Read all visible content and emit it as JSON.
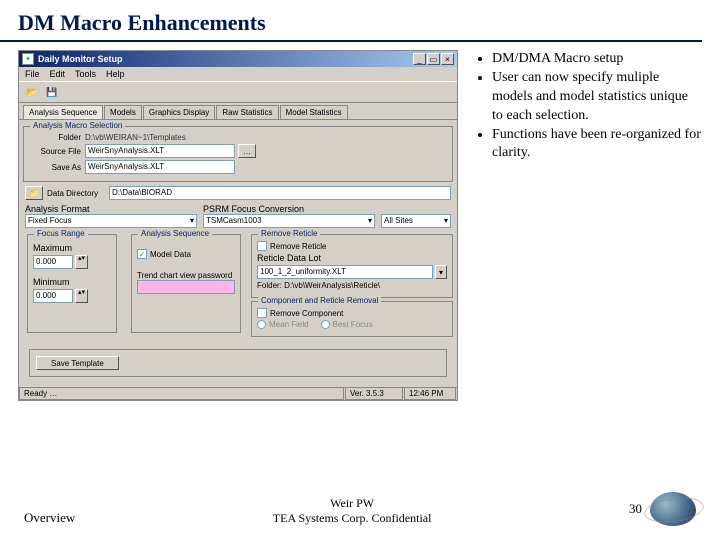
{
  "slide": {
    "title": "DM Macro Enhancements",
    "footer_left": "Overview",
    "footer_center_top": "Weir PW",
    "footer_center_bottom": "TEA Systems Corp. Confidential",
    "page_number": "30"
  },
  "bullets": {
    "b1": "DM/DMA Macro setup",
    "b2": "User can now specify muliple models and model statistics unique to each selection.",
    "b3": "Functions have been re-organized for clarity."
  },
  "app": {
    "title": "Daily Monitor Setup",
    "menu": {
      "file": "File",
      "edit": "Edit",
      "tools": "Tools",
      "help": "Help"
    },
    "tabs": {
      "t1": "Analysis Sequence",
      "t2": "Models",
      "t3": "Graphics Display",
      "t4": "Raw Statistics",
      "t5": "Model Statistics"
    },
    "macro": {
      "group": "Analysis Macro Selection",
      "folder_lbl": "Folder",
      "folder_val": "D:\\vb\\WEIRAN~1\\Templates",
      "source_lbl": "Source File",
      "source_val": "WeirSnyAnalysis.XLT",
      "saveas_lbl": "Save As",
      "saveas_val": "WeirSnyAnalysis.XLT"
    },
    "data_dir_lbl": "Data Directory",
    "data_dir_val": "D:\\Data\\BIORAD",
    "format_lbl": "Analysis Format",
    "format_val": "Fixed Focus",
    "psrm_lbl": "PSRM Focus Conversion",
    "psrm_val": "TSMCasm1003",
    "sites_val": "All Sites",
    "focus": {
      "group": "Focus Range",
      "max_lbl": "Maximum",
      "max_val": "0.000",
      "min_lbl": "Minimum",
      "min_val": "0.000"
    },
    "seq": {
      "group": "Analysis Sequence",
      "model_cb": "Model Data",
      "trend_lbl": "Trend chart view password"
    },
    "reticle": {
      "group": "Remove Reticle",
      "cb": "Remove Reticle",
      "list_lbl": "Reticle Data Lot",
      "list_val": "100_1_2_uniformity.XLT",
      "folder_lbl": "Folder:",
      "folder_val": "D:\\vb\\WeirAnalysis\\Reticle\\",
      "comp_group": "Component and Reticle Removal",
      "comp_cb": "Remove Component",
      "mean_rb": "Mean Field",
      "best_rb": "Best Focus"
    },
    "save_btn": "Save Template",
    "status": {
      "ready": "Ready …",
      "ver": "Ver. 3.5.3",
      "time": "12:46 PM"
    }
  }
}
